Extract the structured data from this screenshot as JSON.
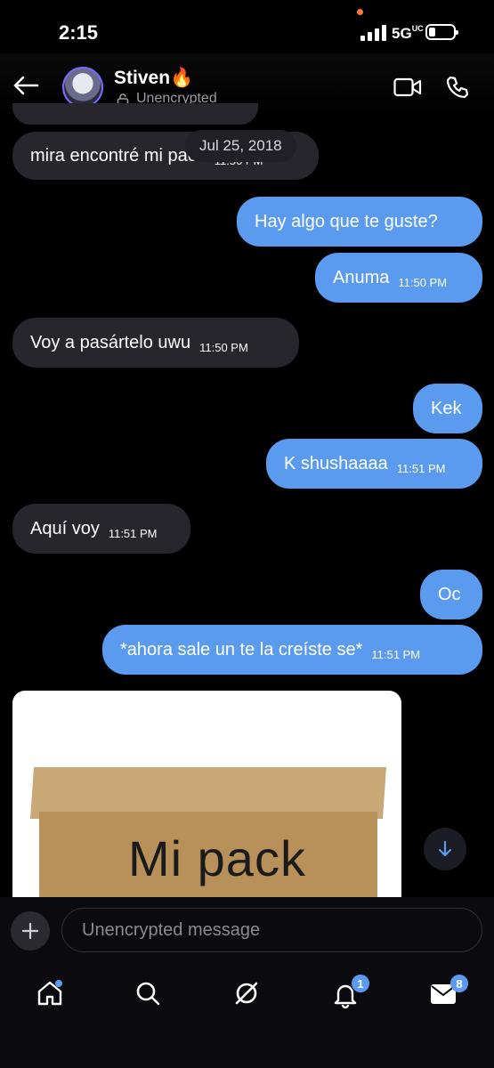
{
  "status_bar": {
    "time": "2:15",
    "network": "5G",
    "network_sup": "UC"
  },
  "header": {
    "name": "Stiven",
    "emoji": "🔥",
    "subtitle": "Unencrypted"
  },
  "messages": [
    {
      "text": "mira encontré mi pack",
      "time": "11:50 PM",
      "dir": "in"
    },
    {
      "text": "Hay algo que te guste?",
      "time": "",
      "dir": "out"
    },
    {
      "text": "Anuma",
      "time": "11:50 PM",
      "dir": "out"
    },
    {
      "text": "Voy a pasártelo uwu",
      "time": "11:50 PM",
      "dir": "in"
    },
    {
      "text": "Kek",
      "time": "",
      "dir": "out"
    },
    {
      "text": "K shushaaaa",
      "time": "11:51 PM",
      "dir": "out"
    },
    {
      "text": "Aquí voy",
      "time": "11:51 PM",
      "dir": "in"
    },
    {
      "text": "Oc",
      "time": "",
      "dir": "out"
    },
    {
      "text": "*ahora sale un te la creíste se*",
      "time": "11:51 PM",
      "dir": "out"
    }
  ],
  "date_pill": "Jul 25, 2018",
  "image": {
    "caption_text": "Mi pack"
  },
  "composer": {
    "placeholder": "Unencrypted message"
  },
  "nav": {
    "home": "home-icon",
    "search": "search-icon",
    "spaces": "spaces-icon",
    "notifications_badge": "1",
    "messages_badge": "8"
  },
  "colors": {
    "accent": "#5b9bef",
    "incoming": "#26262c",
    "background": "#000000"
  }
}
